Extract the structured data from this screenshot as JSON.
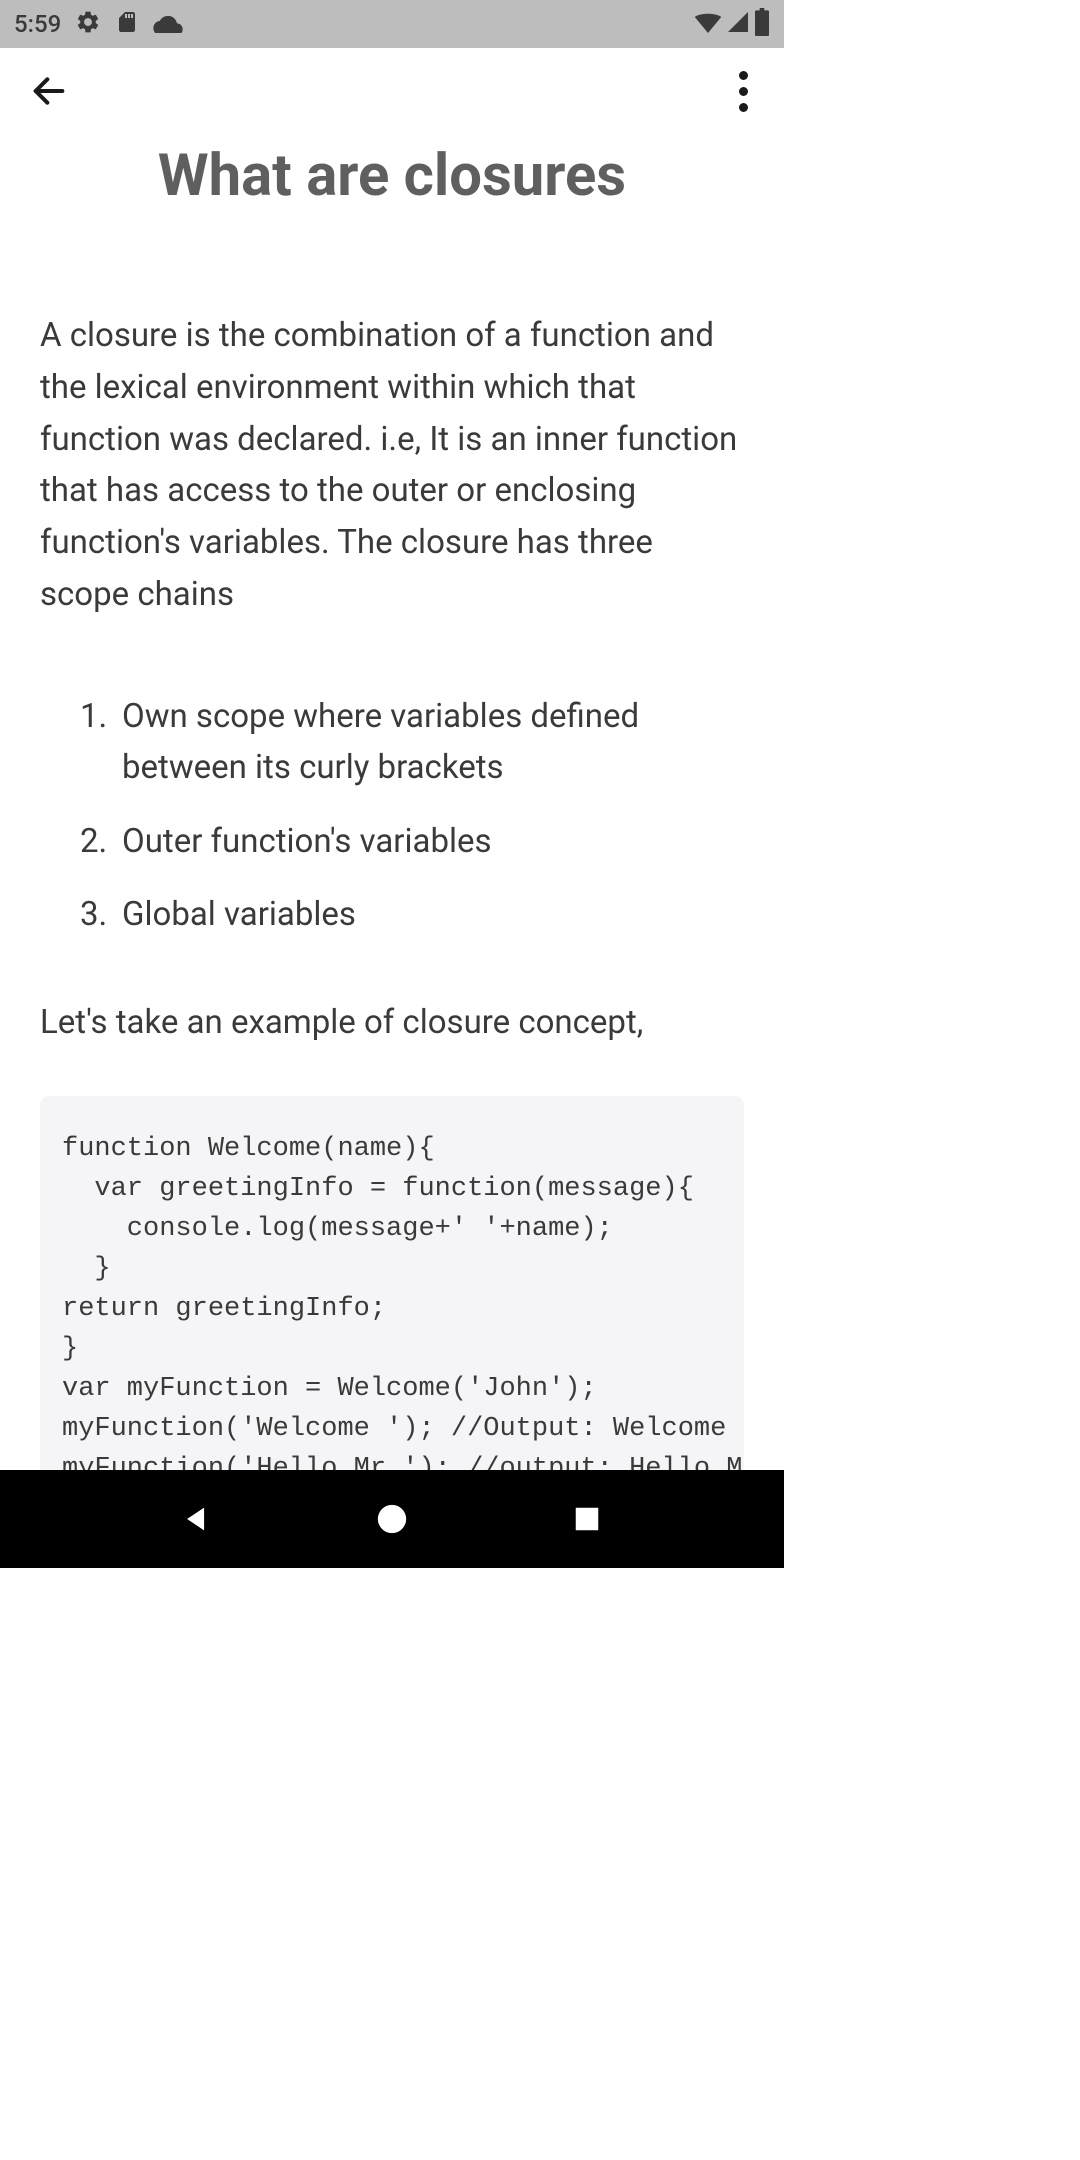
{
  "status_bar": {
    "time": "5:59"
  },
  "app_bar": {
    "back_label": "Back",
    "menu_label": "More options"
  },
  "page": {
    "title": "What are closures",
    "intro": "A closure is the combination of a function and the lexical environment within which that function was declared. i.e, It is an inner function that has access to the outer or enclosing function's variables. The closure has three scope chains",
    "list": [
      {
        "num": "1.",
        "text": "Own scope where variables defined between its curly brackets"
      },
      {
        "num": "2.",
        "text": "Outer function's variables"
      },
      {
        "num": "3.",
        "text": "Global variables"
      }
    ],
    "transition": "Let's take an example of closure concept,",
    "code": "function Welcome(name){\n  var greetingInfo = function(message){\n    console.log(message+' '+name);\n  }\nreturn greetingInfo;\n}\nvar myFunction = Welcome('John');\nmyFunction('Welcome '); //Output: Welcome Jo\nmyFunction('Hello Mr.'); //output: Hello Mr"
  }
}
